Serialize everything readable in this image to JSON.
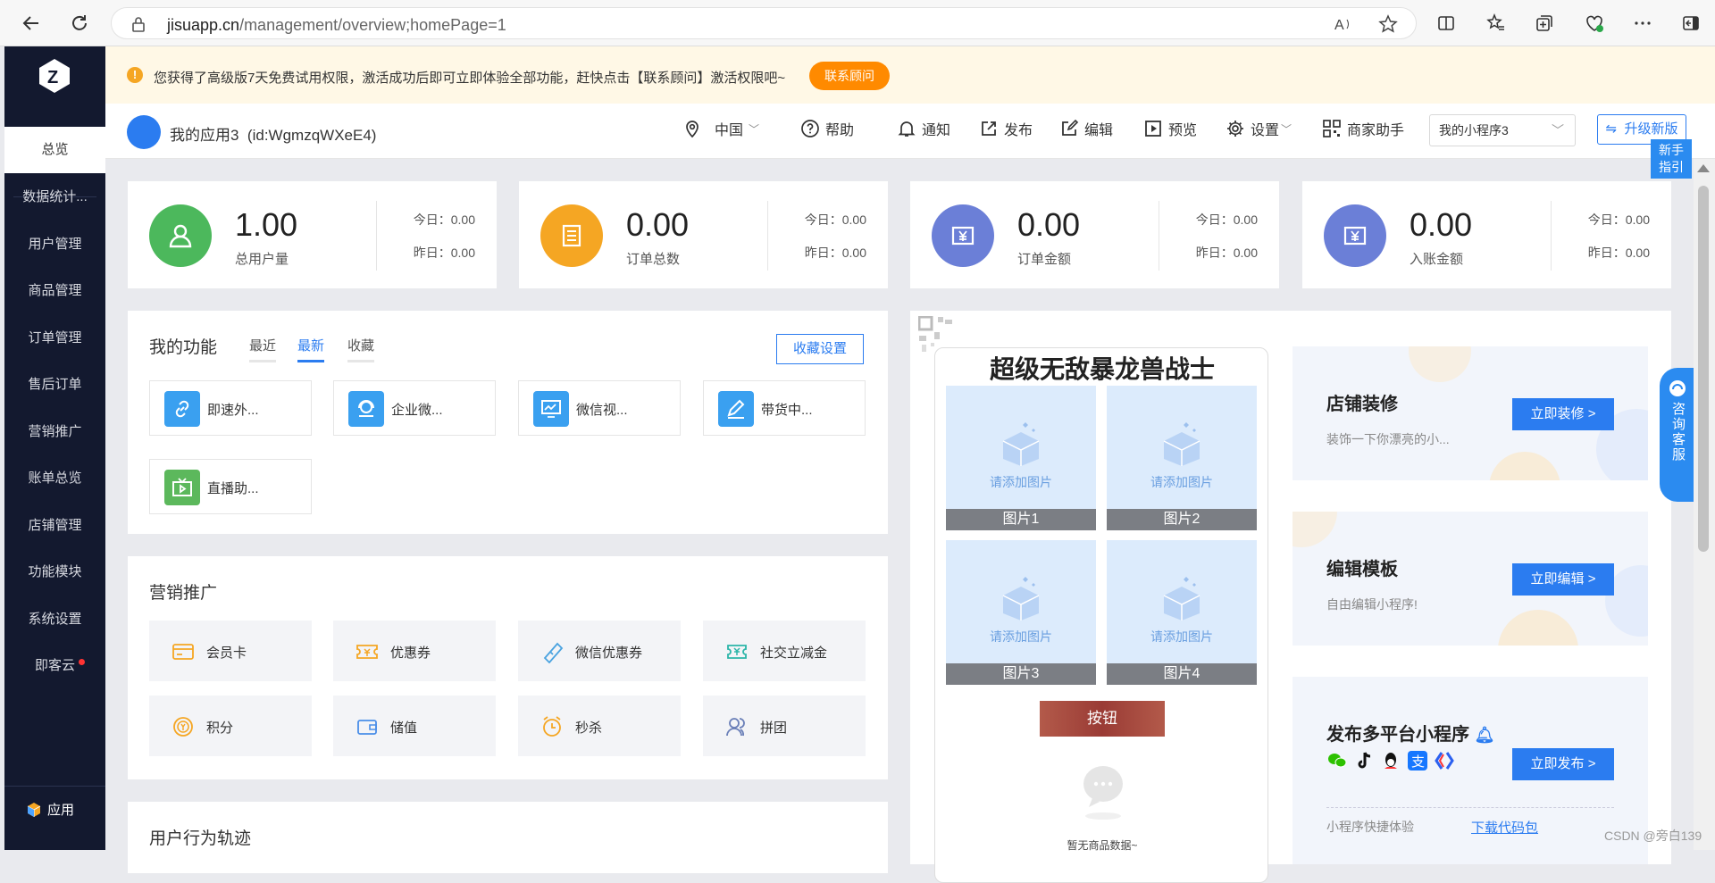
{
  "browser": {
    "url_domain": "jisuapp.cn",
    "url_path": "/management/overview;homePage=1"
  },
  "sidebar": {
    "items": [
      {
        "label": "总览"
      },
      {
        "label": "数据统计..."
      },
      {
        "label": "用户管理"
      },
      {
        "label": "商品管理"
      },
      {
        "label": "订单管理"
      },
      {
        "label": "售后订单"
      },
      {
        "label": "营销推广"
      },
      {
        "label": "账单总览"
      },
      {
        "label": "店铺管理"
      },
      {
        "label": "功能模块"
      },
      {
        "label": "系统设置"
      },
      {
        "label": "即客云"
      }
    ],
    "bottom_label": "应用"
  },
  "notice": {
    "text": "您获得了高级版7天免费试用权限，激活成功后即可立即体验全部功能，赶快点击【联系顾问】激活权限吧~",
    "button": "联系顾问"
  },
  "header": {
    "app_name": "我的应用3",
    "app_id": "(id:WgmzqWXeE4)",
    "region": "中国",
    "help": "帮助",
    "notify": "通知",
    "publish": "发布",
    "edit": "编辑",
    "preview": "预览",
    "settings": "设置",
    "merchant": "商家助手",
    "program_select": "我的小程序3",
    "upgrade": "升级新版",
    "guide_line1": "新手",
    "guide_line2": "指引"
  },
  "stats": [
    {
      "value": "1.00",
      "label": "总用户量",
      "today": "今日：0.00",
      "yesterday": "昨日：0.00",
      "color": "#4cb85c"
    },
    {
      "value": "0.00",
      "label": "订单总数",
      "today": "今日：0.00",
      "yesterday": "昨日：0.00",
      "color": "#f5a623"
    },
    {
      "value": "0.00",
      "label": "订单金额",
      "today": "今日：0.00",
      "yesterday": "昨日：0.00",
      "color": "#6b7fd7"
    },
    {
      "value": "0.00",
      "label": "入账金额",
      "today": "今日：0.00",
      "yesterday": "昨日：0.00",
      "color": "#6b7fd7"
    }
  ],
  "features": {
    "title": "我的功能",
    "tabs": [
      "最近",
      "最新",
      "收藏"
    ],
    "fav_button": "收藏设置",
    "items": [
      {
        "label": "即速外...",
        "icon": "link-icon"
      },
      {
        "label": "企业微...",
        "icon": "service-icon"
      },
      {
        "label": "微信视...",
        "icon": "video-monitor-icon"
      },
      {
        "label": "带货中...",
        "icon": "pen-icon"
      },
      {
        "label": "直播助...",
        "icon": "tv-icon"
      }
    ]
  },
  "marketing": {
    "title": "营销推广",
    "items": [
      {
        "label": "会员卡",
        "icon": "member-card-icon"
      },
      {
        "label": "优惠券",
        "icon": "coupon-icon"
      },
      {
        "label": "微信优惠券",
        "icon": "wechat-coupon-icon"
      },
      {
        "label": "社交立减金",
        "icon": "social-discount-icon"
      },
      {
        "label": "积分",
        "icon": "points-icon"
      },
      {
        "label": "储值",
        "icon": "wallet-icon"
      },
      {
        "label": "秒杀",
        "icon": "alarm-icon"
      },
      {
        "label": "拼团",
        "icon": "group-icon"
      }
    ]
  },
  "behavior": {
    "title": "用户行为轨迹"
  },
  "preview": {
    "title": "超级无敌暴龙兽战士",
    "images": [
      {
        "placeholder": "请添加图片",
        "caption": "图片1"
      },
      {
        "placeholder": "请添加图片",
        "caption": "图片2"
      },
      {
        "placeholder": "请添加图片",
        "caption": "图片3"
      },
      {
        "placeholder": "请添加图片",
        "caption": "图片4"
      }
    ],
    "button": "按钮",
    "no_data": "暂无商品数据~"
  },
  "promos": [
    {
      "title": "店铺装修",
      "sub": "装饰一下你漂亮的小...",
      "button": "立即装修 >"
    },
    {
      "title": "编辑模板",
      "sub": "自由编辑小程序!",
      "button": "立即编辑 >"
    },
    {
      "title": "发布多平台小程序",
      "button": "立即发布 >",
      "quick": "小程序快捷体验",
      "download": "下载代码包"
    }
  ],
  "service": {
    "label": "咨询客服"
  },
  "watermark": "CSDN @旁白139",
  "colors": {
    "primary": "#2b7cf0",
    "sidebar": "#13192f",
    "orange": "#ff8a00"
  }
}
